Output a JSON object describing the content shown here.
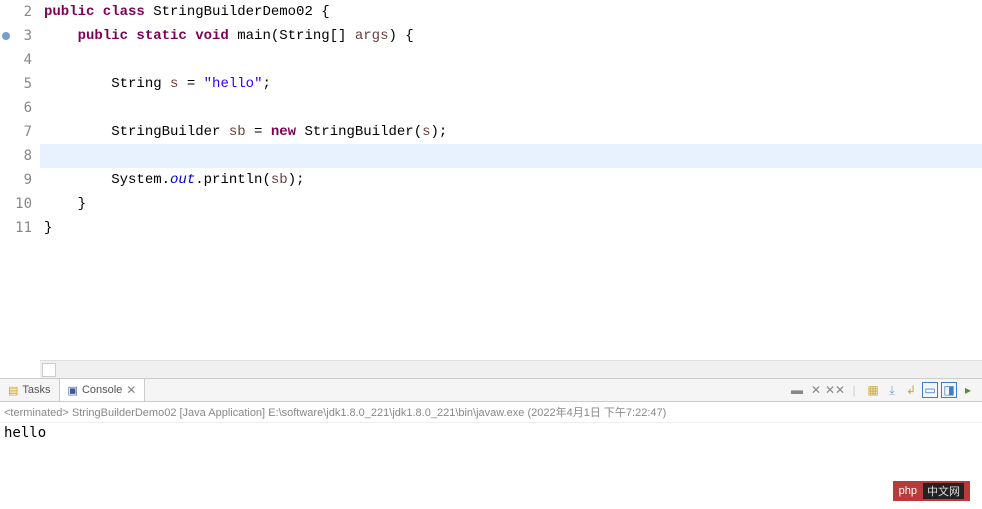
{
  "editor": {
    "lines": [
      {
        "num": "2",
        "marker": false,
        "tokens": [
          [
            "kw-purple",
            "public class"
          ],
          [
            "normal",
            " StringBuilderDemo02 {"
          ]
        ]
      },
      {
        "num": "3",
        "marker": true,
        "tokens": [
          [
            "normal",
            "    "
          ],
          [
            "kw-purple",
            "public static void"
          ],
          [
            "normal",
            " main(String[] "
          ],
          [
            "param",
            "args"
          ],
          [
            "normal",
            ") {"
          ]
        ]
      },
      {
        "num": "4",
        "marker": false,
        "tokens": []
      },
      {
        "num": "5",
        "marker": false,
        "tokens": [
          [
            "normal",
            "        String "
          ],
          [
            "param",
            "s"
          ],
          [
            "normal",
            " = "
          ],
          [
            "str",
            "\"hello\""
          ],
          [
            "normal",
            ";"
          ]
        ]
      },
      {
        "num": "6",
        "marker": false,
        "tokens": []
      },
      {
        "num": "7",
        "marker": false,
        "tokens": [
          [
            "normal",
            "        StringBuilder "
          ],
          [
            "param",
            "sb"
          ],
          [
            "normal",
            " = "
          ],
          [
            "kw-purple",
            "new"
          ],
          [
            "normal",
            " StringBuilder("
          ],
          [
            "param",
            "s"
          ],
          [
            "normal",
            ");"
          ]
        ]
      },
      {
        "num": "8",
        "marker": false,
        "highlighted": true,
        "tokens": []
      },
      {
        "num": "9",
        "marker": false,
        "tokens": [
          [
            "normal",
            "        System."
          ],
          [
            "field-italic",
            "out"
          ],
          [
            "normal",
            ".println("
          ],
          [
            "param",
            "sb"
          ],
          [
            "normal",
            ");"
          ]
        ]
      },
      {
        "num": "10",
        "marker": false,
        "tokens": [
          [
            "normal",
            "    }"
          ]
        ]
      },
      {
        "num": "11",
        "marker": false,
        "tokens": [
          [
            "normal",
            "}"
          ]
        ]
      }
    ]
  },
  "tabs": {
    "tasks": "Tasks",
    "console": "Console"
  },
  "console": {
    "status_prefix": "<terminated>",
    "launch_name": "StringBuilderDemo02 [Java Application]",
    "exe_path": "E:\\software\\jdk1.8.0_221\\jdk1.8.0_221\\bin\\javaw.exe",
    "timestamp": "(2022年4月1日 下午7:22:47)",
    "output": "hello"
  },
  "toolbar": {
    "remove_terminated": "✕",
    "remove_all": "✕✕",
    "divider": "|",
    "scroll_lock": "⬒",
    "pin": "📌",
    "clear": "🗑",
    "display_selected": "📋",
    "open_console": "🖥",
    "new_console": "📄"
  },
  "watermark": {
    "label": "php",
    "suffix": "中文网"
  }
}
